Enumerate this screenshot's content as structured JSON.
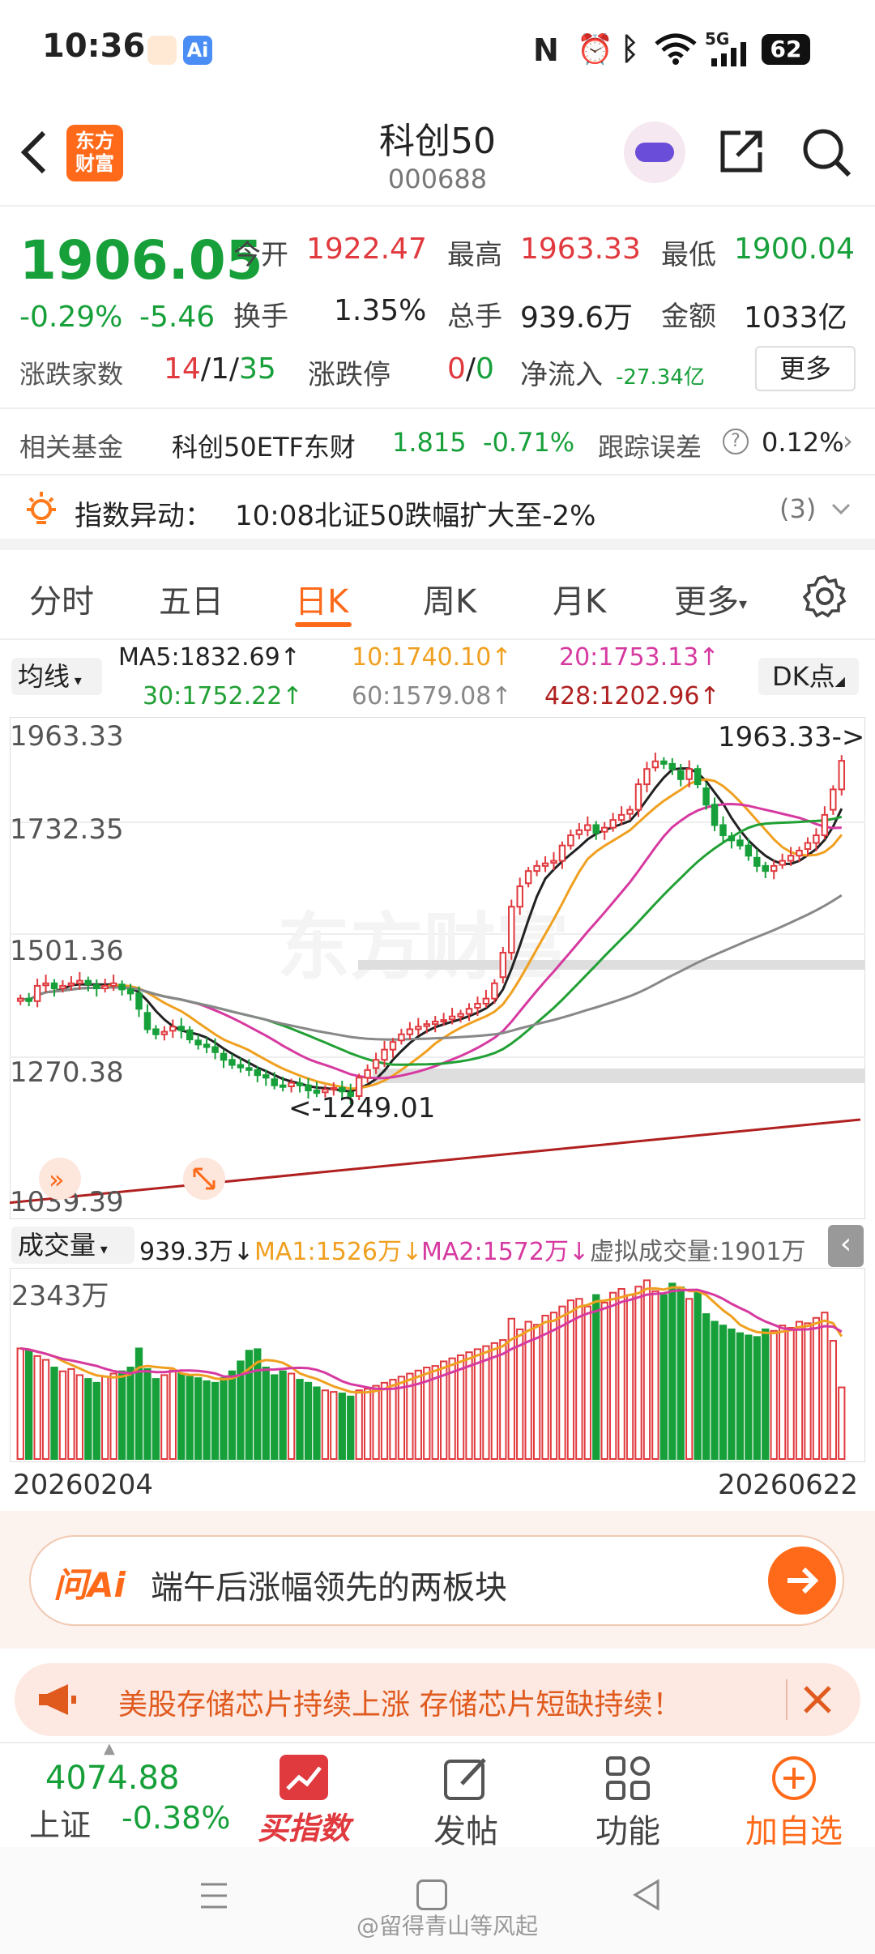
{
  "status_bar": {
    "time": "10:36",
    "battery": "62",
    "network": "5G"
  },
  "header": {
    "title": "科创50",
    "code": "000688",
    "logo_text": "东方\n财富",
    "logo_line1": "东方",
    "logo_line2": "财富"
  },
  "quote": {
    "price": "1906.05",
    "change_pct": "-0.29%",
    "change": "-5.46",
    "open_label": "今开",
    "open": "1922.47",
    "high_label": "最高",
    "high": "1963.33",
    "low_label": "最低",
    "low": "1900.04",
    "turnover_label": "换手",
    "turnover": "1.35%",
    "volume_label": "总手",
    "volume": "939.6万",
    "amount_label": "金额",
    "amount": "1033亿",
    "breadth_label": "涨跌家数",
    "breadth_up": "14",
    "breadth_flat": "1",
    "breadth_down": "35",
    "limit_label": "涨跌停",
    "limit_up": "0",
    "limit_down": "0",
    "inflow_label": "净流入",
    "inflow": "-27.34亿",
    "more_button": "更多"
  },
  "fund": {
    "label": "相关基金",
    "name": "科创50ETF东财",
    "price": "1.815",
    "change": "-0.71%",
    "tracking_label": "跟踪误差",
    "tracking": "0.12%"
  },
  "alert": {
    "label": "指数异动：",
    "text": "10:08北证50跌幅扩大至-2%",
    "count": "(3)"
  },
  "tabs": [
    {
      "label": "分时",
      "active": false
    },
    {
      "label": "五日",
      "active": false
    },
    {
      "label": "日K",
      "active": true
    },
    {
      "label": "周K",
      "active": false
    },
    {
      "label": "月K",
      "active": false
    },
    {
      "label": "更多",
      "active": false
    }
  ],
  "ma_bar": {
    "select": "均线",
    "ma5": "MA5:1832.69↑",
    "ma10": "10:1740.10↑",
    "ma20": "20:1753.13↑",
    "ma30": "30:1752.22↑",
    "ma60": "60:1579.08↑",
    "ma428": "428:1202.96↑",
    "dk_button": "DK点"
  },
  "colors": {
    "up": "#e0393e",
    "down": "#17a03a",
    "accent": "#ff6a1a",
    "ma5": "#222222",
    "ma10": "#f0a020",
    "ma20": "#d63aa0",
    "ma30": "#22a035",
    "ma60": "#888888",
    "ma428": "#b02020"
  },
  "chart_data": {
    "type": "candlestick",
    "y_labels": [
      "1963.33",
      "1732.35",
      "1501.36",
      "1270.38",
      "1039.39"
    ],
    "ylim": [
      1039.39,
      1963.33
    ],
    "annotations": {
      "high": "1963.33->",
      "low": "<-1249.01"
    },
    "watermark": "东方财富",
    "closes": [
      1440,
      1435,
      1465,
      1470,
      1460,
      1465,
      1470,
      1475,
      1468,
      1460,
      1465,
      1470,
      1458,
      1450,
      1420,
      1380,
      1370,
      1375,
      1385,
      1378,
      1360,
      1350,
      1345,
      1335,
      1320,
      1310,
      1305,
      1300,
      1290,
      1285,
      1270,
      1268,
      1275,
      1270,
      1260,
      1255,
      1262,
      1265,
      1258,
      1249,
      1285,
      1300,
      1320,
      1340,
      1355,
      1370,
      1380,
      1385,
      1390,
      1395,
      1398,
      1405,
      1410,
      1420,
      1430,
      1440,
      1470,
      1530,
      1620,
      1660,
      1690,
      1700,
      1705,
      1710,
      1740,
      1760,
      1770,
      1780,
      1765,
      1775,
      1790,
      1800,
      1810,
      1860,
      1890,
      1905,
      1900,
      1890,
      1870,
      1890,
      1860,
      1820,
      1780,
      1760,
      1750,
      1740,
      1720,
      1700,
      1690,
      1700,
      1710,
      1720,
      1730,
      1745,
      1760,
      1800,
      1850,
      1906
    ]
  },
  "volume": {
    "select": "成交量",
    "current": "939.3万↓",
    "ma1": "MA1:1526万↓",
    "ma2": "MA2:1572万↓",
    "virtual": "虚拟成交量:1901万",
    "max_label": "2343万",
    "values": [
      1450,
      1420,
      1350,
      1300,
      1200,
      1150,
      1180,
      1100,
      1050,
      1000,
      1080,
      1120,
      1150,
      1200,
      1450,
      1180,
      1050,
      1100,
      1160,
      1120,
      1080,
      1060,
      1020,
      1000,
      1060,
      1150,
      1280,
      1420,
      1440,
      1200,
      1100,
      1150,
      1120,
      1040,
      1000,
      940,
      900,
      880,
      860,
      820,
      900,
      920,
      960,
      1000,
      1040,
      1080,
      1120,
      1160,
      1200,
      1220,
      1280,
      1320,
      1360,
      1400,
      1440,
      1480,
      1520,
      1560,
      1840,
      1700,
      1800,
      1760,
      1880,
      1920,
      2000,
      2080,
      2100,
      2000,
      2150,
      2050,
      2180,
      2230,
      2150,
      2260,
      2343,
      2200,
      2150,
      2300,
      2250,
      2100,
      2200,
      1900,
      1800,
      1750,
      1700,
      1650,
      1620,
      1600,
      1700,
      1680,
      1750,
      1720,
      1800,
      1780,
      1850,
      1920,
      1550,
      939
    ],
    "dates": [
      "20260204",
      "20260622"
    ]
  },
  "ai_bar": {
    "brand": "问Ai",
    "text": "端午后涨幅领先的两板块"
  },
  "notice": {
    "text": "美股存储芯片持续上涨 存储芯片短缺持续！"
  },
  "bottom_nav": {
    "index_value": "4074.88",
    "index_name": "上证",
    "index_change": "-0.38%",
    "items": [
      {
        "label": "买指数"
      },
      {
        "label": "发帖"
      },
      {
        "label": "功能"
      },
      {
        "label": "加自选"
      }
    ]
  },
  "watermark_bottom": "@留得青山等风起"
}
